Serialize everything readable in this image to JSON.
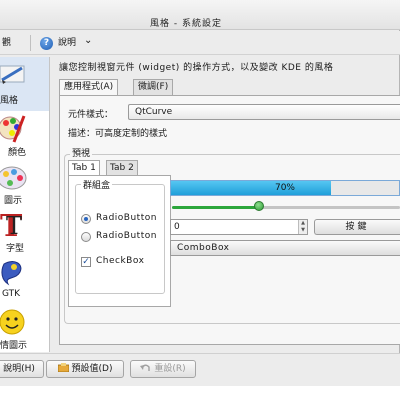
{
  "window": {
    "title": "風格 - 系統設定"
  },
  "toolbar": {
    "overview_label": "觀",
    "help_label": "說明",
    "help_arrow": "⌄"
  },
  "sidebar": {
    "items": [
      {
        "label": "風格",
        "icon": "style-brush-icon",
        "active": true
      },
      {
        "label": "顏色",
        "icon": "colors-palette-icon",
        "active": false
      },
      {
        "label": "圖示",
        "icon": "icons-icon",
        "active": false
      },
      {
        "label": "字型",
        "icon": "fonts-icon",
        "active": false
      },
      {
        "label": "GTK",
        "icon": "gtk-icon",
        "active": false
      },
      {
        "label": "情圖示",
        "icon": "emoticons-smiley-icon",
        "active": false
      }
    ]
  },
  "main": {
    "description": "讓您控制視窗元件 (widget) 的操作方式，以及變改 KDE 的風格",
    "tabs": [
      {
        "label": "應用程式(A)",
        "active": true
      },
      {
        "label": "微調(F)",
        "active": false
      }
    ],
    "widget_style_label": "元件樣式：",
    "widget_style_value": "QtCurve",
    "style_desc_label": "描述：可高度定制的樣式",
    "preview_label": "預視",
    "preview": {
      "tabs": [
        {
          "label": "Tab 1",
          "active": true
        },
        {
          "label": "Tab 2",
          "active": false
        }
      ],
      "group_label": "群組盒",
      "radio1": "RadioButton",
      "radio2": "RadioButton",
      "checkbox": "CheckBox",
      "progress_text": "70%",
      "progress_value": 0.7,
      "slider_value": 0.38,
      "spin_value": "0",
      "push_button": "按鍵",
      "combobox": "ComboBox"
    }
  },
  "bottom": {
    "help_button": "說明(H)",
    "defaults_button": "預設值(D)",
    "reset_button": "重設(R)"
  }
}
